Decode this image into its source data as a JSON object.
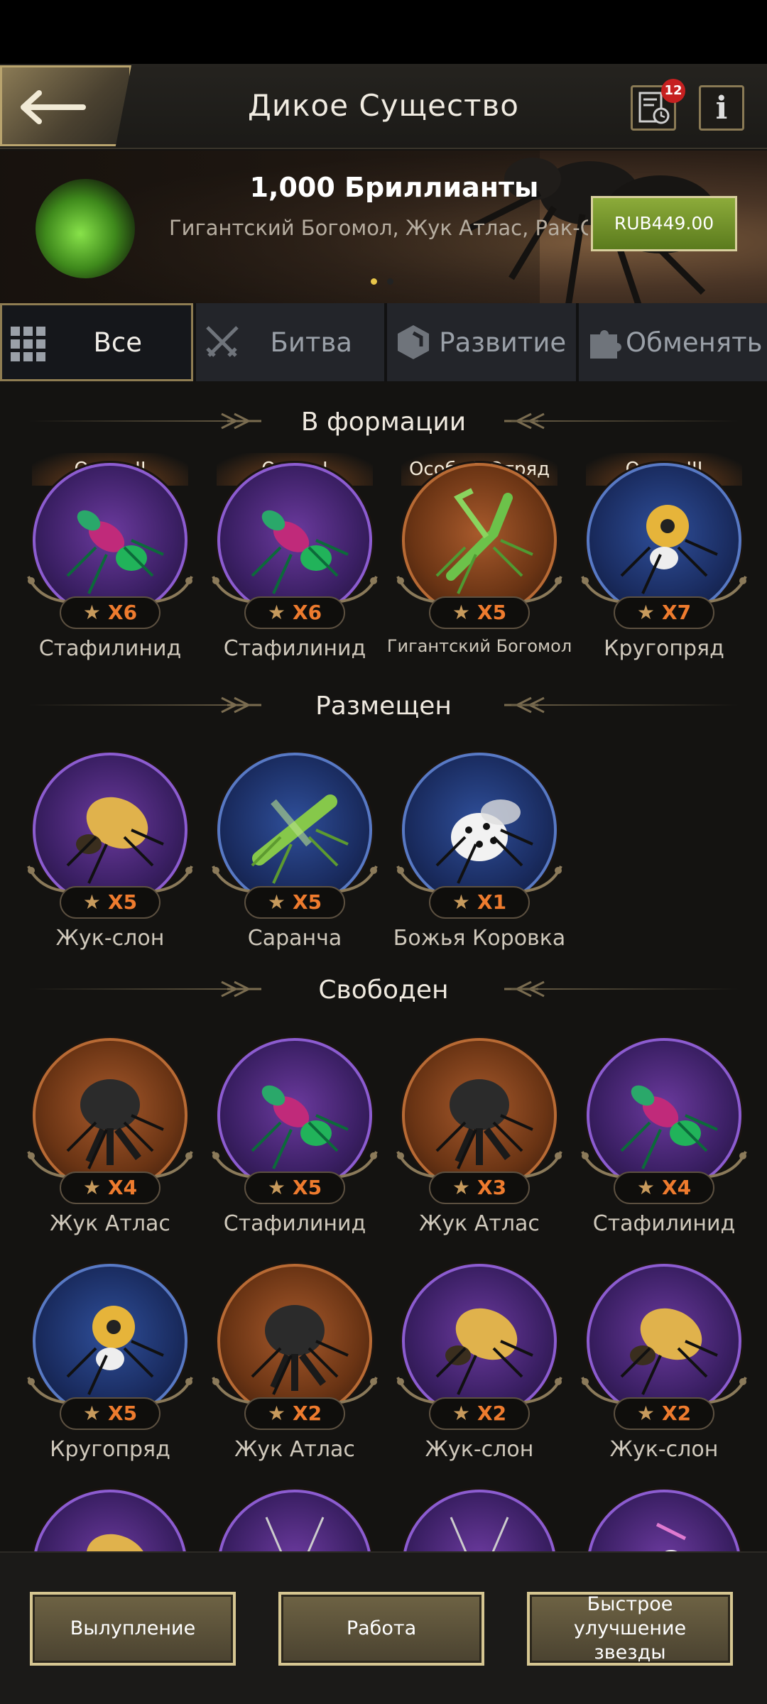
{
  "header": {
    "title": "Дикое Существо",
    "badge_count": "12"
  },
  "banner": {
    "title": "1,000 Бриллианты",
    "subtitle": "Гигантский Богомол, Жук Атлас, Рак-От",
    "price": "RUB449.00"
  },
  "tabs": [
    {
      "label": "Все"
    },
    {
      "label": "Битва"
    },
    {
      "label": "Развитие"
    },
    {
      "label": "Обменять"
    }
  ],
  "sections": {
    "formation": "В формации",
    "placed": "Размещен",
    "free": "Свободен"
  },
  "formation_cards": [
    {
      "squad": "ОтрядII",
      "stars": "X6",
      "name": "Стафилинид",
      "color": "purple",
      "icon": "rove-beetle-icon"
    },
    {
      "squad": "ОтрядI",
      "stars": "X6",
      "name": "Стафилинид",
      "color": "purple",
      "icon": "rove-beetle-icon"
    },
    {
      "squad": "Особый Отряд",
      "stars": "X5",
      "name": "Гигантский Богомол",
      "color": "orange",
      "icon": "mantis-icon"
    },
    {
      "squad": "ОтрядIII",
      "stars": "X7",
      "name": "Кругопряд",
      "color": "blue",
      "icon": "spider-icon"
    }
  ],
  "placed_cards": [
    {
      "stars": "X5",
      "name": "Жук-слон",
      "color": "purple",
      "icon": "elephant-beetle-icon"
    },
    {
      "stars": "X5",
      "name": "Саранча",
      "color": "blue",
      "icon": "locust-icon"
    },
    {
      "stars": "X1",
      "name": "Божья Коровка",
      "color": "blue",
      "icon": "ladybug-icon"
    }
  ],
  "free_cards": [
    {
      "stars": "X4",
      "name": "Жук Атлас",
      "color": "orange",
      "icon": "atlas-beetle-icon"
    },
    {
      "stars": "X5",
      "name": "Стафилинид",
      "color": "purple",
      "icon": "rove-beetle-icon"
    },
    {
      "stars": "X3",
      "name": "Жук Атлас",
      "color": "orange",
      "icon": "atlas-beetle-icon"
    },
    {
      "stars": "X4",
      "name": "Стафилинид",
      "color": "purple",
      "icon": "rove-beetle-icon"
    },
    {
      "stars": "X5",
      "name": "Кругопряд",
      "color": "blue",
      "icon": "spider-icon"
    },
    {
      "stars": "X2",
      "name": "Жук Атлас",
      "color": "orange",
      "icon": "atlas-beetle-icon"
    },
    {
      "stars": "X2",
      "name": "Жук-слон",
      "color": "purple",
      "icon": "elephant-beetle-icon"
    },
    {
      "stars": "X2",
      "name": "Жук-слон",
      "color": "purple",
      "icon": "elephant-beetle-icon"
    }
  ],
  "partial_row": [
    {
      "color": "purple",
      "icon": "elephant-beetle-icon"
    },
    {
      "color": "purple",
      "icon": "longhorn-beetle-icon"
    },
    {
      "color": "purple",
      "icon": "longhorn-beetle-icon"
    },
    {
      "color": "purple",
      "icon": "orchid-mantis-icon"
    }
  ],
  "bottom": {
    "hatch": "Вылупление",
    "work": "Работа",
    "upgrade": "Быстрое улучшение звезды"
  },
  "colors": {
    "accent_gold": "#b9a46e",
    "star_text": "#ee7b2e",
    "buy_green": "#7a9a2c"
  }
}
